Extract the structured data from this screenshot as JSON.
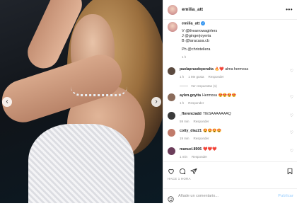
{
  "header": {
    "username": "emilia_att",
    "more_icon": "ellipsis-icon",
    "more_label": "•••"
  },
  "caption": {
    "username": "emilia_att",
    "lines": [
      "V @thearrowagirlers",
      "J @gingerjoyeria",
      "B @laracasa.cb"
    ],
    "credit": "Ph @christeliera",
    "time": "1 h"
  },
  "comments": [
    {
      "user": "paolaprasdoperalta",
      "text": "🔥❤️ alma hermosa",
      "time": "1 h",
      "likes": "1 Me gusta",
      "reply": "Responder",
      "avatar_color": "#5b4a3f",
      "see_replies": "Ver respuestas (1)"
    },
    {
      "user": "aylen.goyita",
      "text": "Hermosa 😍😍😍😍",
      "time": "1 h",
      "reply": "Responder",
      "avatar_color": "#8a6b5a"
    },
    {
      "user": "_florenciadd",
      "text": "TIESAAAAAAAQ",
      "time": "59 min",
      "reply": "Responder",
      "avatar_color": "#3a3a3a"
    },
    {
      "user": "cotty_diaz21",
      "text": "😍😍😍😍",
      "time": "19 min",
      "reply": "Responder",
      "avatar_color": "#c07a6a"
    },
    {
      "user": "manuel.8906",
      "text": "❤️❤️❤️",
      "time": "1 min",
      "reply": "Responder",
      "avatar_color": "#6b3d5a"
    }
  ],
  "actions": {
    "like_icon": "heart-icon",
    "comment_icon": "comment-icon",
    "share_icon": "share-icon",
    "save_icon": "bookmark-icon"
  },
  "date": "HACE 1 HORA",
  "add_comment": {
    "placeholder": "Añade un comentario...",
    "publish_label": "Publicar",
    "emoji_icon": "emoji-icon"
  },
  "photo": {
    "prev_icon": "chevron-left-icon",
    "next_icon": "chevron-right-icon",
    "prev_glyph": "‹",
    "next_glyph": "›"
  }
}
